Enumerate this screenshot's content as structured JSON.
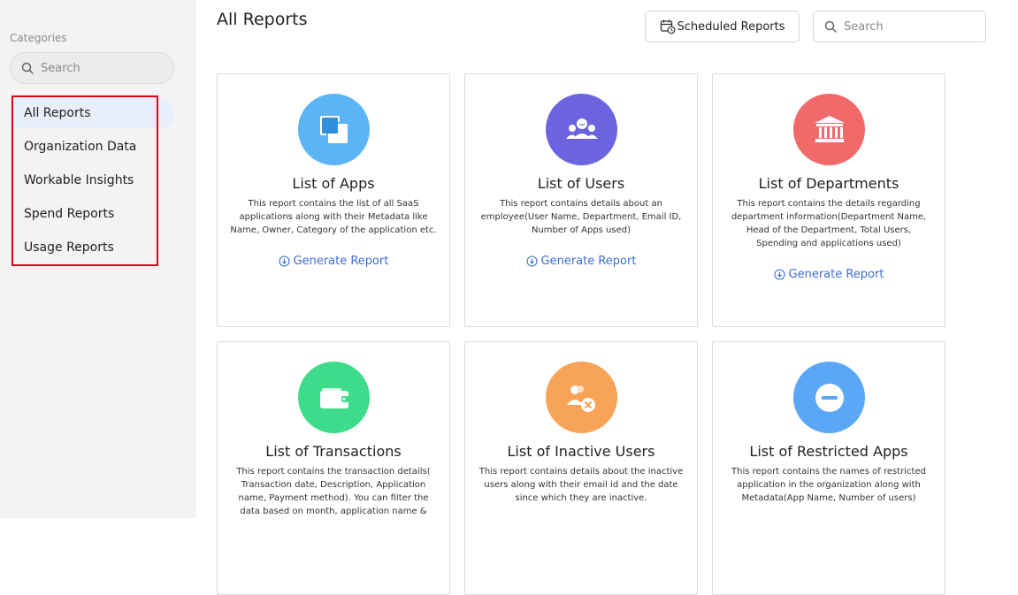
{
  "sidebar": {
    "categories_label": "Categories",
    "search_placeholder": "Search",
    "items": [
      {
        "label": "All Reports",
        "active": true
      },
      {
        "label": "Organization Data"
      },
      {
        "label": "Workable Insights"
      },
      {
        "label": "Spend Reports"
      },
      {
        "label": "Usage Reports"
      }
    ]
  },
  "header": {
    "title": "All Reports",
    "scheduled_label": "Scheduled Reports",
    "search_placeholder": "Search"
  },
  "cards": [
    {
      "title": "List of Apps",
      "description": "This report contains the list of all SaaS applications along with their Metadata like Name, Owner, Category of the application etc.",
      "action": "Generate Report",
      "icon": "apps-icon",
      "color": "#5bb4f5"
    },
    {
      "title": "List of Users",
      "description": "This report contains details about an employee(User Name, Department, Email ID, Number of Apps used)",
      "action": "Generate Report",
      "icon": "users-icon",
      "color": "#6b63e0"
    },
    {
      "title": "List of Departments",
      "description": "This report contains the details regarding department information(Department Name, Head of the Department, Total Users, Spending and applications used)",
      "action": "Generate Report",
      "icon": "building-icon",
      "color": "#f2696a"
    },
    {
      "title": "List of Transactions",
      "description": "This report contains the transaction details( Transaction date, Description, Application name, Payment method). You can filter the data based on month, application name &",
      "icon": "wallet-icon",
      "color": "#3ddc8a"
    },
    {
      "title": "List of Inactive Users",
      "description": "This report contains details about the inactive users along with their email id and the date since which they are inactive.",
      "icon": "inactive-users-icon",
      "color": "#f7a458"
    },
    {
      "title": "List of Restricted Apps",
      "description": "This report contains the names of restricted application in the organization along with Metadata(App Name, Number of users)",
      "icon": "restricted-icon",
      "color": "#5aa7f5"
    }
  ],
  "colors": {
    "sidebar_bg": "#f3f3f3",
    "active_bg": "#e8eefa",
    "link": "#3b6fd1",
    "highlight_border": "#e0001b"
  }
}
